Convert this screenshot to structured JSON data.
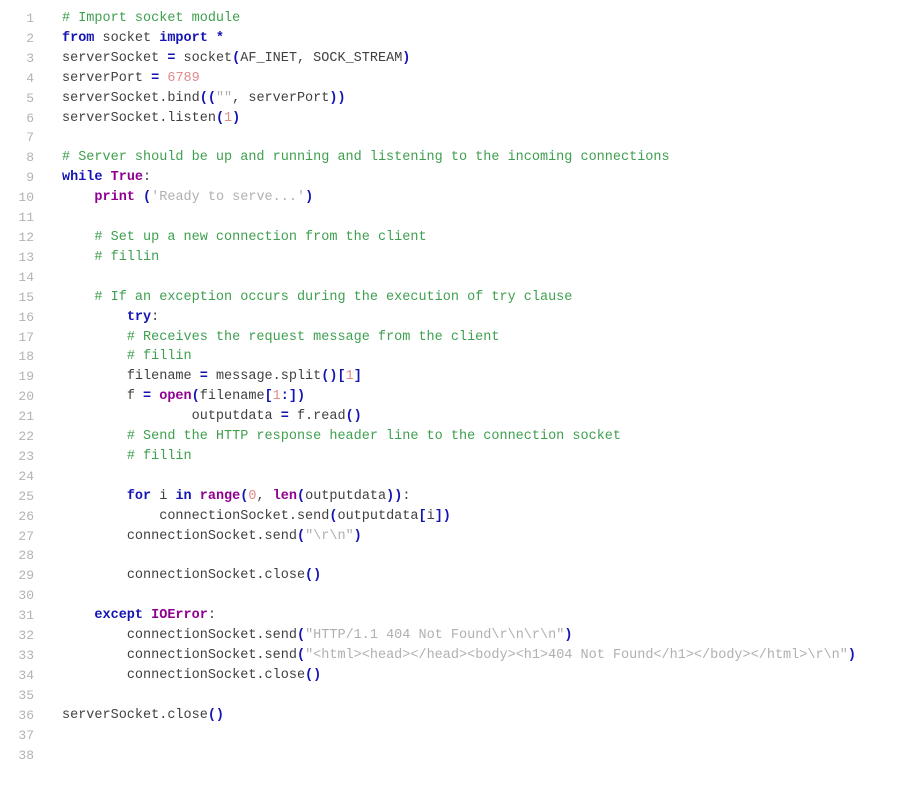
{
  "editor": {
    "language": "python",
    "background_color": "#ffffff",
    "line_number_color": "#b3b3b3",
    "first_line_number": 1,
    "last_line_number": 38,
    "total_lines": 38
  },
  "theme": {
    "plain": "#404040",
    "comment": "#3f9f4f",
    "keyword": "#1414b4",
    "builtin": "#900090",
    "constant": "#900090",
    "string": "#b0b0b0",
    "number": "#e08a8a",
    "operator": "#1414b4",
    "bracket": "#1414b4"
  },
  "lines": [
    {
      "number": "1",
      "tokens": [
        {
          "t": "comment",
          "s": "# Import socket module"
        }
      ]
    },
    {
      "number": "2",
      "tokens": [
        {
          "t": "keyword",
          "s": "from"
        },
        {
          "t": "plain",
          "s": " socket "
        },
        {
          "t": "keyword",
          "s": "import"
        },
        {
          "t": "operator",
          "s": " *"
        }
      ]
    },
    {
      "number": "3",
      "tokens": [
        {
          "t": "plain",
          "s": "serverSocket "
        },
        {
          "t": "operator",
          "s": "="
        },
        {
          "t": "plain",
          "s": " socket"
        },
        {
          "t": "bracket",
          "s": "("
        },
        {
          "t": "plain",
          "s": "AF_INET, SOCK_STREAM"
        },
        {
          "t": "bracket",
          "s": ")"
        }
      ]
    },
    {
      "number": "4",
      "tokens": [
        {
          "t": "plain",
          "s": "serverPort "
        },
        {
          "t": "operator",
          "s": "="
        },
        {
          "t": "plain",
          "s": " "
        },
        {
          "t": "number",
          "s": "6789"
        }
      ]
    },
    {
      "number": "5",
      "tokens": [
        {
          "t": "plain",
          "s": "serverSocket.bind"
        },
        {
          "t": "bracket",
          "s": "(("
        },
        {
          "t": "string",
          "s": "\"\""
        },
        {
          "t": "plain",
          "s": ", serverPort"
        },
        {
          "t": "bracket",
          "s": "))"
        }
      ]
    },
    {
      "number": "6",
      "tokens": [
        {
          "t": "plain",
          "s": "serverSocket.listen"
        },
        {
          "t": "bracket",
          "s": "("
        },
        {
          "t": "number",
          "s": "1"
        },
        {
          "t": "bracket",
          "s": ")"
        }
      ]
    },
    {
      "number": "7",
      "tokens": []
    },
    {
      "number": "8",
      "tokens": [
        {
          "t": "comment",
          "s": "# Server should be up and running and listening to the incoming connections"
        }
      ]
    },
    {
      "number": "9",
      "tokens": [
        {
          "t": "keyword",
          "s": "while"
        },
        {
          "t": "plain",
          "s": " "
        },
        {
          "t": "constant",
          "s": "True"
        },
        {
          "t": "punct",
          "s": ":"
        }
      ]
    },
    {
      "number": "10",
      "tokens": [
        {
          "t": "plain",
          "s": "    "
        },
        {
          "t": "builtin",
          "s": "print"
        },
        {
          "t": "plain",
          "s": " "
        },
        {
          "t": "bracket",
          "s": "("
        },
        {
          "t": "string",
          "s": "'Ready to serve...'"
        },
        {
          "t": "bracket",
          "s": ")"
        }
      ]
    },
    {
      "number": "11",
      "tokens": []
    },
    {
      "number": "12",
      "tokens": [
        {
          "t": "plain",
          "s": "    "
        },
        {
          "t": "comment",
          "s": "# Set up a new connection from the client"
        }
      ]
    },
    {
      "number": "13",
      "tokens": [
        {
          "t": "plain",
          "s": "    "
        },
        {
          "t": "comment",
          "s": "# fillin"
        }
      ]
    },
    {
      "number": "14",
      "tokens": []
    },
    {
      "number": "15",
      "tokens": [
        {
          "t": "plain",
          "s": "    "
        },
        {
          "t": "comment",
          "s": "# If an exception occurs during the execution of try clause"
        }
      ]
    },
    {
      "number": "16",
      "tokens": [
        {
          "t": "plain",
          "s": "        "
        },
        {
          "t": "keyword",
          "s": "try"
        },
        {
          "t": "punct",
          "s": ":"
        }
      ]
    },
    {
      "number": "17",
      "tokens": [
        {
          "t": "plain",
          "s": "        "
        },
        {
          "t": "comment",
          "s": "# Receives the request message from the client"
        }
      ]
    },
    {
      "number": "18",
      "tokens": [
        {
          "t": "plain",
          "s": "        "
        },
        {
          "t": "comment",
          "s": "# fillin"
        }
      ]
    },
    {
      "number": "19",
      "tokens": [
        {
          "t": "plain",
          "s": "        filename "
        },
        {
          "t": "operator",
          "s": "="
        },
        {
          "t": "plain",
          "s": " message.split"
        },
        {
          "t": "bracket",
          "s": "()["
        },
        {
          "t": "number",
          "s": "1"
        },
        {
          "t": "bracket",
          "s": "]"
        }
      ]
    },
    {
      "number": "20",
      "tokens": [
        {
          "t": "plain",
          "s": "        f "
        },
        {
          "t": "operator",
          "s": "="
        },
        {
          "t": "plain",
          "s": " "
        },
        {
          "t": "builtin",
          "s": "open"
        },
        {
          "t": "bracket",
          "s": "("
        },
        {
          "t": "plain",
          "s": "filename"
        },
        {
          "t": "bracket",
          "s": "["
        },
        {
          "t": "number",
          "s": "1"
        },
        {
          "t": "bracket",
          "s": ":])"
        }
      ]
    },
    {
      "number": "21",
      "tokens": [
        {
          "t": "plain",
          "s": "                outputdata "
        },
        {
          "t": "operator",
          "s": "="
        },
        {
          "t": "plain",
          "s": " f.read"
        },
        {
          "t": "bracket",
          "s": "()"
        }
      ]
    },
    {
      "number": "22",
      "tokens": [
        {
          "t": "plain",
          "s": "        "
        },
        {
          "t": "comment",
          "s": "# Send the HTTP response header line to the connection socket"
        }
      ]
    },
    {
      "number": "23",
      "tokens": [
        {
          "t": "plain",
          "s": "        "
        },
        {
          "t": "comment",
          "s": "# fillin"
        }
      ]
    },
    {
      "number": "24",
      "tokens": []
    },
    {
      "number": "25",
      "tokens": [
        {
          "t": "plain",
          "s": "        "
        },
        {
          "t": "keyword",
          "s": "for"
        },
        {
          "t": "plain",
          "s": " i "
        },
        {
          "t": "keyword",
          "s": "in"
        },
        {
          "t": "plain",
          "s": " "
        },
        {
          "t": "builtin",
          "s": "range"
        },
        {
          "t": "bracket",
          "s": "("
        },
        {
          "t": "number",
          "s": "0"
        },
        {
          "t": "plain",
          "s": ", "
        },
        {
          "t": "builtin",
          "s": "len"
        },
        {
          "t": "bracket",
          "s": "("
        },
        {
          "t": "plain",
          "s": "outputdata"
        },
        {
          "t": "bracket",
          "s": "))"
        },
        {
          "t": "punct",
          "s": ":"
        }
      ]
    },
    {
      "number": "26",
      "tokens": [
        {
          "t": "plain",
          "s": "            connectionSocket.send"
        },
        {
          "t": "bracket",
          "s": "("
        },
        {
          "t": "plain",
          "s": "outputdata"
        },
        {
          "t": "bracket",
          "s": "["
        },
        {
          "t": "plain",
          "s": "i"
        },
        {
          "t": "bracket",
          "s": "])"
        }
      ]
    },
    {
      "number": "27",
      "tokens": [
        {
          "t": "plain",
          "s": "        connectionSocket.send"
        },
        {
          "t": "bracket",
          "s": "("
        },
        {
          "t": "string",
          "s": "\"\\r\\n\""
        },
        {
          "t": "bracket",
          "s": ")"
        }
      ]
    },
    {
      "number": "28",
      "tokens": []
    },
    {
      "number": "29",
      "tokens": [
        {
          "t": "plain",
          "s": "        connectionSocket.close"
        },
        {
          "t": "bracket",
          "s": "()"
        }
      ]
    },
    {
      "number": "30",
      "tokens": []
    },
    {
      "number": "31",
      "tokens": [
        {
          "t": "plain",
          "s": "    "
        },
        {
          "t": "keyword",
          "s": "except"
        },
        {
          "t": "plain",
          "s": " "
        },
        {
          "t": "builtin",
          "s": "IOError"
        },
        {
          "t": "punct",
          "s": ":"
        }
      ]
    },
    {
      "number": "32",
      "tokens": [
        {
          "t": "plain",
          "s": "        connectionSocket.send"
        },
        {
          "t": "bracket",
          "s": "("
        },
        {
          "t": "string",
          "s": "\"HTTP/1.1 404 Not Found\\r\\n\\r\\n\""
        },
        {
          "t": "bracket",
          "s": ")"
        }
      ]
    },
    {
      "number": "33",
      "tokens": [
        {
          "t": "plain",
          "s": "        connectionSocket.send"
        },
        {
          "t": "bracket",
          "s": "("
        },
        {
          "t": "string",
          "s": "\"<html><head></head><body><h1>404 Not Found</h1></body></html>\\r\\n\""
        },
        {
          "t": "bracket",
          "s": ")"
        }
      ]
    },
    {
      "number": "34",
      "tokens": [
        {
          "t": "plain",
          "s": "        connectionSocket.close"
        },
        {
          "t": "bracket",
          "s": "()"
        }
      ]
    },
    {
      "number": "35",
      "tokens": []
    },
    {
      "number": "36",
      "tokens": [
        {
          "t": "plain",
          "s": "serverSocket.close"
        },
        {
          "t": "bracket",
          "s": "()"
        }
      ]
    },
    {
      "number": "37",
      "tokens": []
    },
    {
      "number": "38",
      "tokens": []
    }
  ]
}
